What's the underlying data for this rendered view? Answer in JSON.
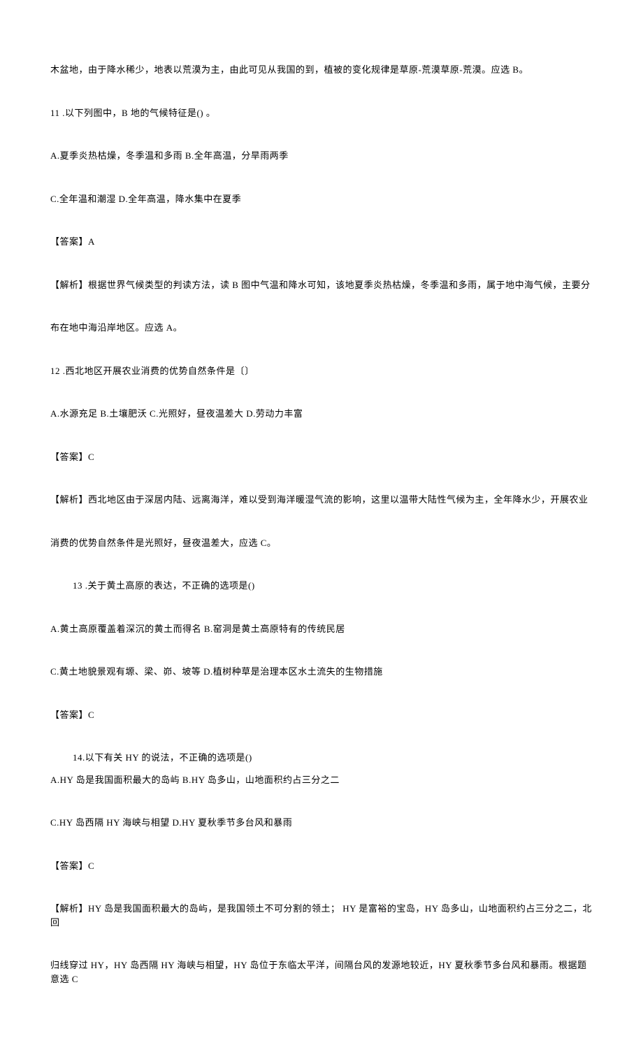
{
  "lines": [
    {
      "text": "木盆地，由于降水稀少，地表以荒漠为主，由此可见从我国的到，植被的变化规律是草原-荒漠草原-荒漠。应选 B。",
      "class": "para"
    },
    {
      "text": "11 .以下列图中，B 地的气候特征是() 。",
      "class": "para"
    },
    {
      "text": "A.夏季炎热枯燥，冬季温和多雨 B.全年高温，分旱雨两季",
      "class": "para"
    },
    {
      "text": "C.全年温和潮湿 D.全年高温，降水集中在夏季",
      "class": "para"
    },
    {
      "text": "【答案】A",
      "class": "para"
    },
    {
      "text": "【解析】根据世界气候类型的判读方法，读 B 图中气温和降水可知，该地夏季炎热枯燥，冬季温和多雨，属于地中海气候，主要分",
      "class": "para"
    },
    {
      "text": "布在地中海沿岸地区。应选 A。",
      "class": "para"
    },
    {
      "text": "12 .西北地区开展农业消费的优势自然条件是〔〕",
      "class": "para"
    },
    {
      "text": "A.水源充足 B.土壤肥沃 C.光照好，昼夜温差大 D.劳动力丰富",
      "class": "para"
    },
    {
      "text": "【答案】C",
      "class": "para"
    },
    {
      "text": "【解析】西北地区由于深居内陆、远离海洋，难以受到海洋暖湿气流的影响，这里以温带大陆性气候为主，全年降水少，开展农业",
      "class": "para"
    },
    {
      "text": "消费的优势自然条件是光照好，昼夜温差大，应选 C。",
      "class": "para"
    },
    {
      "text": "13 .关于黄土高原的表达，不正确的选项是()",
      "class": "para indent"
    },
    {
      "text": "A.黄土高原覆盖着深沉的黄土而得名 B.窑洞是黄土高原特有的传统民居",
      "class": "para"
    },
    {
      "text": "C.黄土地貌景观有塬、梁、峁、坡等 D.植树种草是治理本区水土流失的生物措施",
      "class": "para"
    },
    {
      "text": "【答案】C",
      "class": "para"
    },
    {
      "text": "14.以下有关 HY 的说法，不正确的选项是()",
      "class": "para-tight indent"
    },
    {
      "text": "A.HY 岛是我国面积最大的岛屿 B.HY 岛多山，山地面积约占三分之二",
      "class": "para"
    },
    {
      "text": "C.HY 岛西隔 HY 海峡与相望 D.HY 夏秋季节多台风和暴雨",
      "class": "para"
    },
    {
      "text": "【答案】C",
      "class": "para"
    },
    {
      "text": "【解析】HY 岛是我国面积最大的岛屿，是我国领土不可分割的领土； HY 是富裕的宝岛，HY 岛多山，山地面积约占三分之二，北回",
      "class": "para"
    },
    {
      "text": "归线穿过 HY，HY 岛西隔 HY 海峡与相望，HY 岛位于东临太平洋，间隔台风的发源地较近，HY 夏秋季节多台风和暴雨。根据题意选 C",
      "class": "para"
    }
  ]
}
